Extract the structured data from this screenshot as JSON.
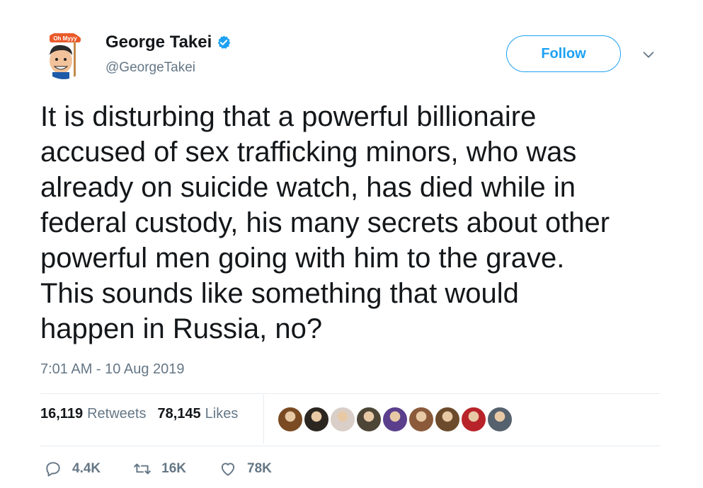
{
  "user": {
    "name": "George Takei",
    "handle": "@GeorgeTakei",
    "avatar_sign": "Oh Myyy"
  },
  "follow_label": "Follow",
  "tweet_lines": [
    "It is disturbing that a powerful billionaire",
    "accused of sex trafficking minors, who was",
    "already on suicide watch, has died while in",
    "federal custody, his many secrets about other",
    "powerful men going with him to the grave.",
    "This sounds like something that would",
    "happen in Russia, no?"
  ],
  "timestamp": "7:01 AM - 10 Aug 2019",
  "stats": {
    "retweets_count": "16,119",
    "retweets_label": "Retweets",
    "likes_count": "78,145",
    "likes_label": "Likes"
  },
  "liker_colors": [
    "#7a4a22",
    "#2c2621",
    "#d9cfc8",
    "#4d4637",
    "#5b3f8c",
    "#8a5a3a",
    "#6b4b2b",
    "#b8232a",
    "#55616d"
  ],
  "actions": {
    "reply_count": "4.4K",
    "retweet_count": "16K",
    "like_count": "78K"
  },
  "colors": {
    "accent": "#1da1f2",
    "muted": "#657786",
    "text": "#14171a"
  }
}
